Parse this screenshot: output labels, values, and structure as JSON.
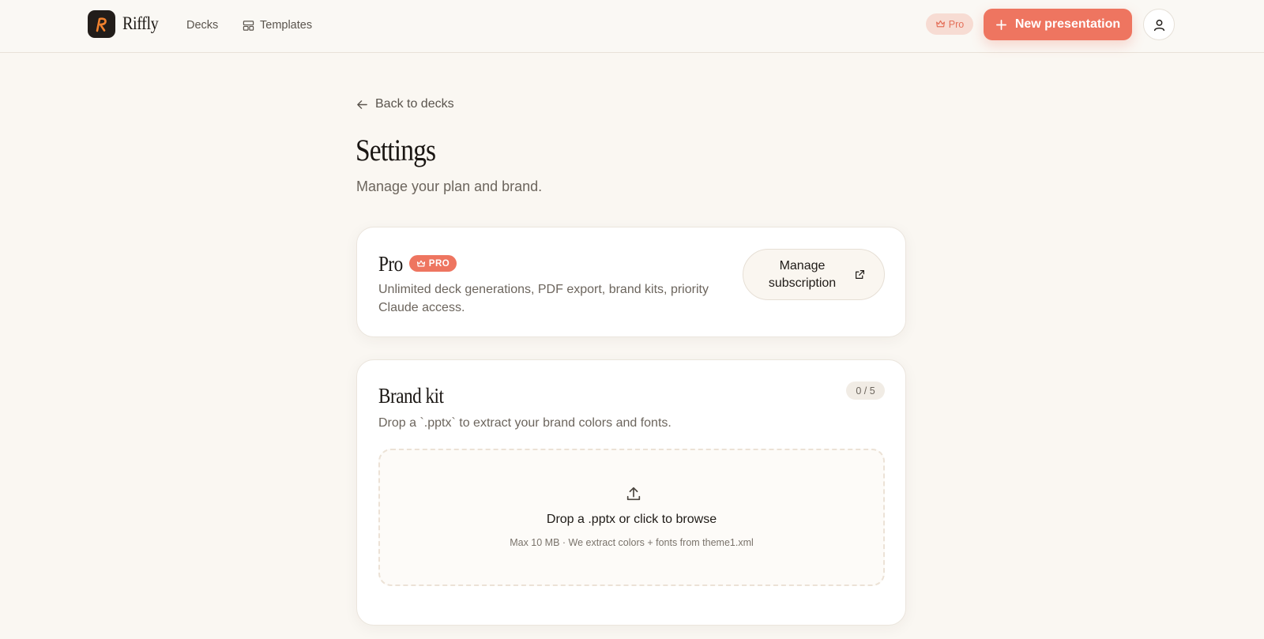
{
  "header": {
    "brand_name": "Riffly",
    "nav": {
      "decks_label": "Decks",
      "templates_label": "Templates"
    },
    "pro_pill_label": "Pro",
    "new_presentation_label": "New presentation"
  },
  "main": {
    "back_label": "Back to decks",
    "title": "Settings",
    "subtitle": "Manage your plan and brand."
  },
  "plan_card": {
    "title": "Pro",
    "badge": "PRO",
    "description": "Unlimited deck generations, PDF export, brand kits, priority Claude access.",
    "manage_label": "Manage subscription"
  },
  "brand_card": {
    "title": "Brand kit",
    "count": "0 / 5",
    "description": "Drop a `.pptx` to extract your brand colors and fonts.",
    "dropzone": {
      "title": "Drop a .pptx or click to browse",
      "hint": "Max 10 MB · We extract colors + fonts from theme1.xml"
    }
  },
  "colors": {
    "accent": "#ee7560",
    "accent_soft": "#f7dcd3",
    "background": "#faf7f2",
    "logo_tile": "#221d1a",
    "logo_glyph": "#f0812e"
  },
  "icons": {
    "logo": "r-logo-icon",
    "templates": "layout-grid-icon",
    "crown": "crown-icon",
    "plus": "plus-icon",
    "user": "user-icon",
    "back": "arrow-left-icon",
    "external": "external-link-icon",
    "upload": "upload-icon"
  }
}
